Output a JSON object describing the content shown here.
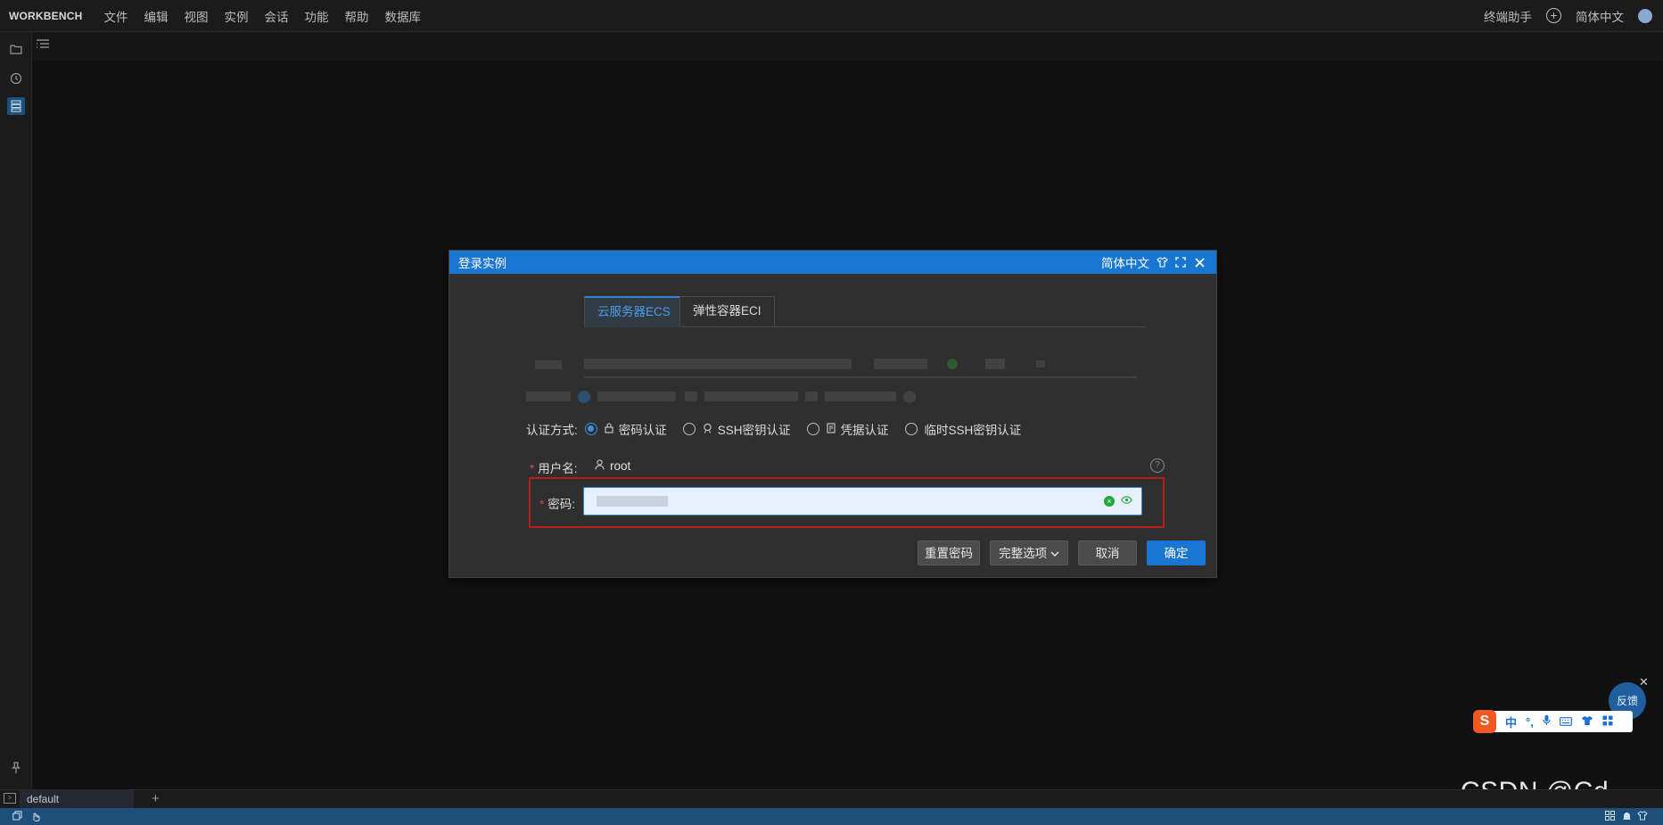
{
  "app": {
    "brand": "WORKBENCH",
    "menu": [
      "文件",
      "编辑",
      "视图",
      "实例",
      "会话",
      "功能",
      "帮助",
      "数据库"
    ],
    "top_right": {
      "assistant": "终端助手",
      "add_icon": "+",
      "language": "简体中文",
      "avatar_icon": "user-avatar"
    }
  },
  "left_sidebar": {
    "icons": [
      "folder-icon",
      "history-icon",
      "database-list-icon",
      "pin-icon"
    ]
  },
  "bottom": {
    "terminal_tab": "default",
    "add_tab_label": "+"
  },
  "dialog": {
    "title": "登录实例",
    "language": "简体中文",
    "tabs": [
      "云服务器ECS",
      "弹性容器ECI"
    ],
    "active_tab": "云服务器ECS",
    "auth": {
      "label": "认证方式:",
      "options": [
        "密码认证",
        "SSH密钥认证",
        "凭据认证",
        "临时SSH密钥认证"
      ],
      "selected": "密码认证"
    },
    "username": {
      "label": "用户名:",
      "value": "root"
    },
    "password": {
      "label": "密码:"
    },
    "buttons": {
      "reset": "重置密码",
      "full_options": "完整选项",
      "cancel": "取消",
      "confirm": "确定"
    }
  },
  "floating": {
    "feedback": "反馈",
    "close": "✕",
    "ime": {
      "logo": "S",
      "items": [
        "中",
        "°,",
        "🎤",
        "⌨",
        "👕",
        "⊞"
      ]
    }
  },
  "watermark": "CSDN @Cd ...",
  "colors": {
    "accent": "#1976d2",
    "highlight": "#b91c1c",
    "status_bar": "#1e4f7a"
  }
}
